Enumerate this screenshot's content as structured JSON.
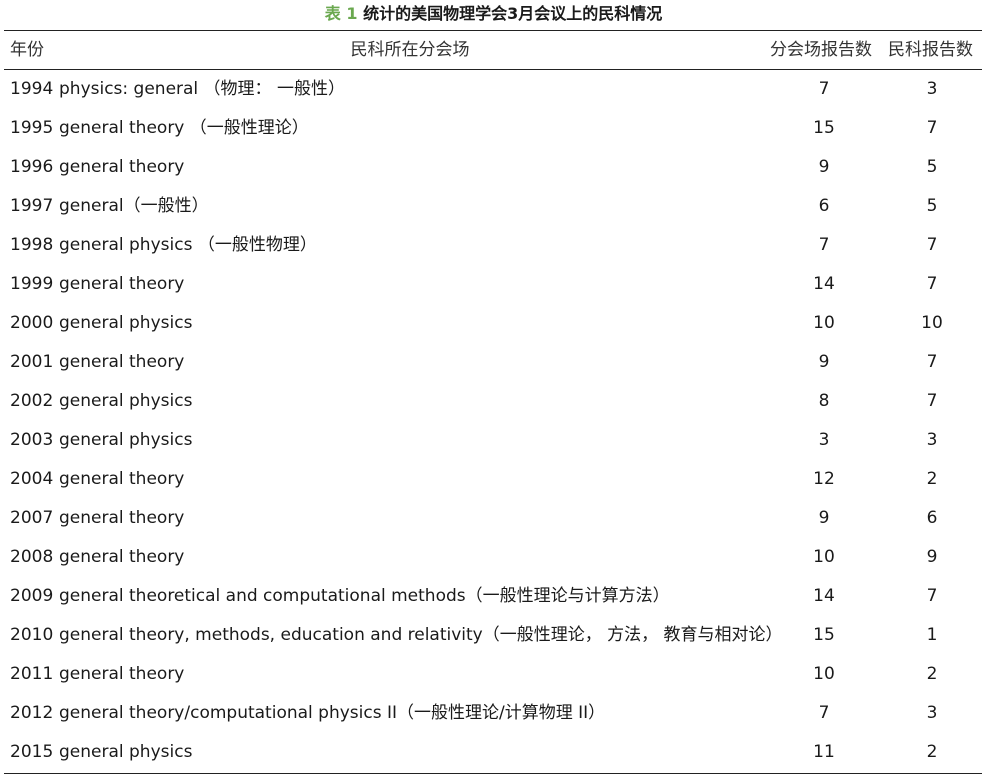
{
  "caption": {
    "label": "表 1",
    "text": "统计的美国物理学会3月会议上的民科情况"
  },
  "headers": {
    "year": "年份",
    "session": "民科所在分会场",
    "reports": "分会场报告数",
    "cranks": "民科报告数"
  },
  "rows": [
    {
      "year": "1994",
      "session": "physics: general （物理： 一般性）",
      "reports": "7",
      "cranks": "3"
    },
    {
      "year": "1995",
      "session": "general theory （一般性理论）",
      "reports": "15",
      "cranks": "7"
    },
    {
      "year": "1996",
      "session": "general theory",
      "reports": "9",
      "cranks": "5"
    },
    {
      "year": "1997",
      "session": "general（一般性）",
      "reports": "6",
      "cranks": "5"
    },
    {
      "year": "1998",
      "session": "general physics （一般性物理）",
      "reports": "7",
      "cranks": "7"
    },
    {
      "year": "1999",
      "session": "general theory",
      "reports": "14",
      "cranks": "7"
    },
    {
      "year": "2000",
      "session": "general physics",
      "reports": "10",
      "cranks": "10"
    },
    {
      "year": "2001",
      "session": "general theory",
      "reports": "9",
      "cranks": "7"
    },
    {
      "year": "2002",
      "session": "general physics",
      "reports": "8",
      "cranks": "7"
    },
    {
      "year": "2003",
      "session": "general physics",
      "reports": "3",
      "cranks": "3"
    },
    {
      "year": "2004",
      "session": "general theory",
      "reports": "12",
      "cranks": "2"
    },
    {
      "year": "2007",
      "session": "general theory",
      "reports": "9",
      "cranks": "6"
    },
    {
      "year": "2008",
      "session": "general theory",
      "reports": "10",
      "cranks": "9"
    },
    {
      "year": "2009",
      "session": "general theoretical and computational methods（一般性理论与计算方法）",
      "reports": "14",
      "cranks": "7"
    },
    {
      "year": "2010",
      "session": "general theory, methods, education and relativity（一般性理论， 方法， 教育与相对论）",
      "reports": "15",
      "cranks": "1"
    },
    {
      "year": "2011",
      "session": "general theory",
      "reports": "10",
      "cranks": "2"
    },
    {
      "year": "2012",
      "session": "general theory/computational physics II（一般性理论/计算物理 II）",
      "reports": "7",
      "cranks": "3"
    },
    {
      "year": "2015",
      "session": "general physics",
      "reports": "11",
      "cranks": "2"
    }
  ]
}
